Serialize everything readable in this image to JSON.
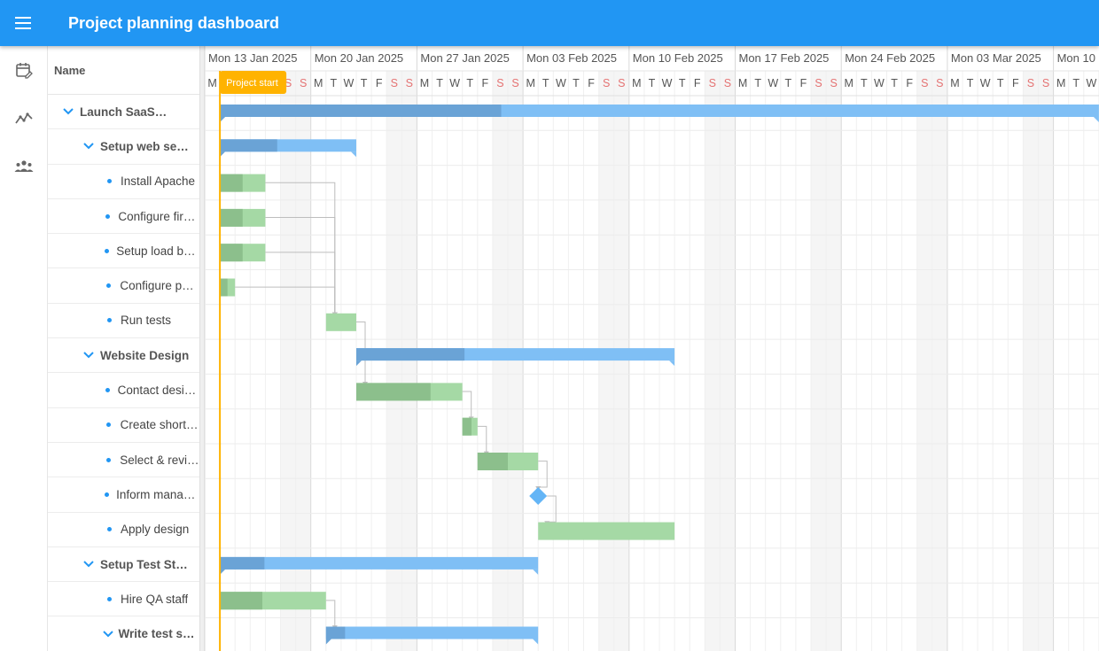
{
  "app": {
    "title": "Project planning dashboard"
  },
  "nav": {
    "items": [
      {
        "id": "calendar",
        "icon": "calendar-edit-icon"
      },
      {
        "id": "timeline",
        "icon": "chart-timeline-icon"
      },
      {
        "id": "team",
        "icon": "team-icon"
      }
    ]
  },
  "tree": {
    "header": "Name",
    "rows": [
      {
        "label": "Launch SaaS Product",
        "level": 0,
        "type": "parent"
      },
      {
        "label": "Setup web server",
        "level": 1,
        "type": "parent"
      },
      {
        "label": "Install Apache",
        "level": 2,
        "type": "leaf"
      },
      {
        "label": "Configure firewall",
        "level": 2,
        "type": "leaf"
      },
      {
        "label": "Setup load balancer",
        "level": 2,
        "type": "leaf"
      },
      {
        "label": "Configure ports",
        "level": 2,
        "type": "leaf"
      },
      {
        "label": "Run tests",
        "level": 2,
        "type": "leaf"
      },
      {
        "label": "Website Design",
        "level": 1,
        "type": "parent"
      },
      {
        "label": "Contact designers",
        "level": 2,
        "type": "leaf"
      },
      {
        "label": "Create shortlist",
        "level": 2,
        "type": "leaf"
      },
      {
        "label": "Select & review",
        "level": 2,
        "type": "leaf"
      },
      {
        "label": "Inform management",
        "level": 2,
        "type": "leaf"
      },
      {
        "label": "Apply design",
        "level": 2,
        "type": "leaf"
      },
      {
        "label": "Setup Test Strategy",
        "level": 1,
        "type": "parent"
      },
      {
        "label": "Hire QA staff",
        "level": 2,
        "type": "leaf"
      },
      {
        "label": "Write test specs",
        "level": 2,
        "type": "parent"
      }
    ]
  },
  "timeline": {
    "weeks": [
      "Mon 13 Jan 2025",
      "Mon 20 Jan 2025",
      "Mon 27 Jan 2025",
      "Mon 03 Feb 2025",
      "Mon 10 Feb 2025",
      "Mon 17 Feb 2025",
      "Mon 24 Feb 2025",
      "Mon 03 Mar 2025",
      "Mon 10"
    ],
    "day_letters": [
      "M",
      "T",
      "W",
      "T",
      "F",
      "S",
      "S"
    ],
    "project_start_label": "Project start",
    "project_start_day": 1
  },
  "tasks": [
    {
      "row": 0,
      "kind": "summary",
      "start": 1,
      "end": 59,
      "progress": 0.32
    },
    {
      "row": 1,
      "kind": "summary",
      "start": 1,
      "end": 10,
      "progress": 0.42
    },
    {
      "row": 2,
      "kind": "task",
      "start": 1,
      "end": 4,
      "progress": 0.5
    },
    {
      "row": 3,
      "kind": "task",
      "start": 1,
      "end": 4,
      "progress": 0.5
    },
    {
      "row": 4,
      "kind": "task",
      "start": 1,
      "end": 4,
      "progress": 0.5
    },
    {
      "row": 5,
      "kind": "task",
      "start": 1,
      "end": 2,
      "progress": 0.5
    },
    {
      "row": 6,
      "kind": "task",
      "start": 8,
      "end": 10,
      "progress": 0
    },
    {
      "row": 7,
      "kind": "summary",
      "start": 10,
      "end": 31,
      "progress": 0.34
    },
    {
      "row": 8,
      "kind": "task",
      "start": 10,
      "end": 17,
      "progress": 0.7
    },
    {
      "row": 9,
      "kind": "task",
      "start": 17,
      "end": 18,
      "progress": 0.6
    },
    {
      "row": 10,
      "kind": "task",
      "start": 18,
      "end": 22,
      "progress": 0.5
    },
    {
      "row": 11,
      "kind": "milestone",
      "start": 22
    },
    {
      "row": 12,
      "kind": "task",
      "start": 22,
      "end": 31,
      "progress": 0
    },
    {
      "row": 13,
      "kind": "summary",
      "start": 1,
      "end": 22,
      "progress": 0.14
    },
    {
      "row": 14,
      "kind": "task",
      "start": 1,
      "end": 8,
      "progress": 0.4
    },
    {
      "row": 15,
      "kind": "summary",
      "start": 8,
      "end": 22,
      "progress": 0.09
    }
  ],
  "dependencies": [
    {
      "from": 2,
      "to": 6
    },
    {
      "from": 3,
      "to": 6
    },
    {
      "from": 4,
      "to": 6
    },
    {
      "from": 5,
      "to": 6
    },
    {
      "from": 6,
      "to": 8
    },
    {
      "from": 8,
      "to": 9
    },
    {
      "from": 9,
      "to": 10
    },
    {
      "from": 10,
      "to": 11
    },
    {
      "from": 11,
      "to": 12
    },
    {
      "from": 14,
      "to": 15
    }
  ],
  "colors": {
    "accent": "#2196f3",
    "summary_fill": "#7fbff5",
    "summary_progress": "#6aa3d6",
    "task_fill": "#a5d9a5",
    "task_progress": "#8cbf8c",
    "milestone": "#64b5f6",
    "project_start": "#ffb300",
    "weekend_bg": "#f5f5f5",
    "weekend_text": "#e57373"
  }
}
